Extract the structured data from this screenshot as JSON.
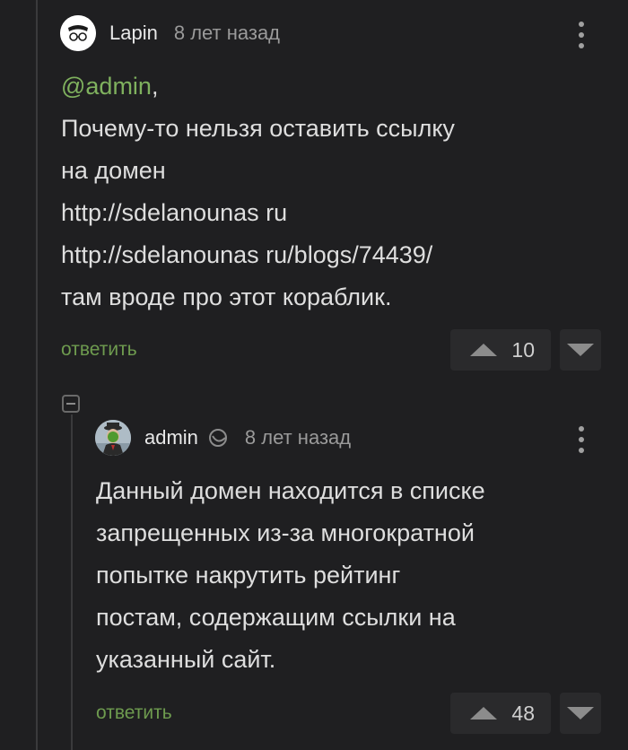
{
  "comment1": {
    "author": "Lapin",
    "time": "8 лет назад",
    "mention": "@admin",
    "mention_suffix": ",",
    "lines": [
      "Почему-то нельзя оставить ссылку",
      "на домен",
      "http://sdelanounas ru",
      "http://sdelanounas ru/blogs/74439/",
      "там вроде про этот кораблик."
    ],
    "reply_label": "ответить",
    "rating": "10"
  },
  "comment2": {
    "author": "admin",
    "time": "8 лет назад",
    "lines": [
      "Данный домен находится в списке",
      "запрещенных из-за многократной",
      "попытке накрутить рейтинг",
      "постам, содержащим ссылки на",
      "указанный сайт."
    ],
    "reply_label": "ответить",
    "rating": "48"
  },
  "colors": {
    "background": "#1f1f21",
    "accent_green": "#7fb15e",
    "muted": "#9a9a9a"
  }
}
